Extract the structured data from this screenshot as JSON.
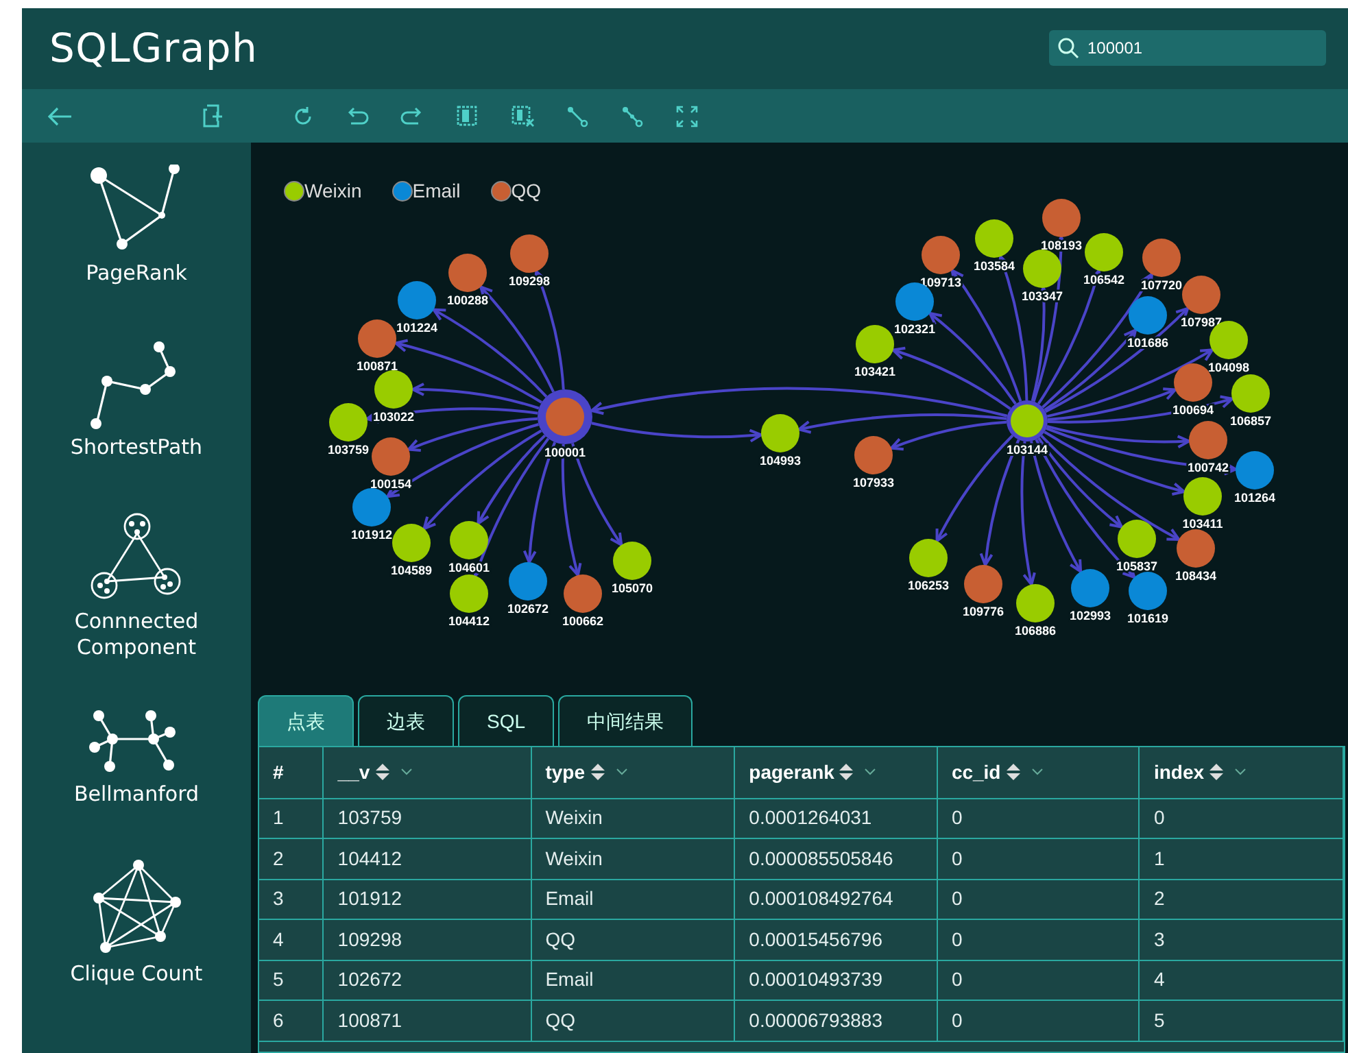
{
  "app": {
    "title": "SQLGraph"
  },
  "search": {
    "value": "100001"
  },
  "sidebar": {
    "items": [
      {
        "label": "PageRank"
      },
      {
        "label": "ShortestPath"
      },
      {
        "label": "Connnected Component"
      },
      {
        "label": "Bellmanford"
      },
      {
        "label": "Clique Count"
      }
    ]
  },
  "graph": {
    "legend": [
      {
        "label": "Weixin",
        "color": "#99cc00"
      },
      {
        "label": "Email",
        "color": "#0a88d6"
      },
      {
        "label": "QQ",
        "color": "#c85f33"
      }
    ],
    "nodes": [
      {
        "label": "100001",
        "color": "#c85f33",
        "selected": true
      },
      {
        "label": "100288",
        "color": "#c85f33",
        "selected": false
      },
      {
        "label": "109298",
        "color": "#c85f33",
        "selected": false
      },
      {
        "label": "101224",
        "color": "#0a88d6",
        "selected": false
      },
      {
        "label": "100871",
        "color": "#c85f33",
        "selected": false
      },
      {
        "label": "103022",
        "color": "#99cc00",
        "selected": false
      },
      {
        "label": "103759",
        "color": "#99cc00",
        "selected": false
      },
      {
        "label": "100154",
        "color": "#c85f33",
        "selected": false
      },
      {
        "label": "101912",
        "color": "#0a88d6",
        "selected": false
      },
      {
        "label": "104589",
        "color": "#99cc00",
        "selected": false
      },
      {
        "label": "104601",
        "color": "#99cc00",
        "selected": false
      },
      {
        "label": "104412",
        "color": "#99cc00",
        "selected": false
      },
      {
        "label": "102672",
        "color": "#0a88d6",
        "selected": false
      },
      {
        "label": "100662",
        "color": "#c85f33",
        "selected": false
      },
      {
        "label": "105070",
        "color": "#99cc00",
        "selected": false
      },
      {
        "label": "103144",
        "color": "#99cc00",
        "selected": false
      },
      {
        "label": "109713",
        "color": "#c85f33",
        "selected": false
      },
      {
        "label": "103584",
        "color": "#99cc00",
        "selected": false
      },
      {
        "label": "108193",
        "color": "#c85f33",
        "selected": false
      },
      {
        "label": "103347",
        "color": "#99cc00",
        "selected": false
      },
      {
        "label": "106542",
        "color": "#99cc00",
        "selected": false
      },
      {
        "label": "107720",
        "color": "#c85f33",
        "selected": false
      },
      {
        "label": "102321",
        "color": "#0a88d6",
        "selected": false
      },
      {
        "label": "101686",
        "color": "#0a88d6",
        "selected": false
      },
      {
        "label": "107987",
        "color": "#c85f33",
        "selected": false
      },
      {
        "label": "103421",
        "color": "#99cc00",
        "selected": false
      },
      {
        "label": "104098",
        "color": "#99cc00",
        "selected": false
      },
      {
        "label": "100694",
        "color": "#c85f33",
        "selected": false
      },
      {
        "label": "106857",
        "color": "#99cc00",
        "selected": false
      },
      {
        "label": "100742",
        "color": "#c85f33",
        "selected": false
      },
      {
        "label": "101264",
        "color": "#0a88d6",
        "selected": false
      },
      {
        "label": "103411",
        "color": "#99cc00",
        "selected": false
      },
      {
        "label": "108434",
        "color": "#c85f33",
        "selected": false
      },
      {
        "label": "105837",
        "color": "#99cc00",
        "selected": false
      },
      {
        "label": "102993",
        "color": "#0a88d6",
        "selected": false
      },
      {
        "label": "101619",
        "color": "#0a88d6",
        "selected": false
      },
      {
        "label": "106886",
        "color": "#99cc00",
        "selected": false
      },
      {
        "label": "109776",
        "color": "#c85f33",
        "selected": false
      },
      {
        "label": "106253",
        "color": "#99cc00",
        "selected": false
      },
      {
        "label": "107933",
        "color": "#c85f33",
        "selected": false
      },
      {
        "label": "104993",
        "color": "#99cc00",
        "selected": false
      }
    ]
  },
  "result_tabs": [
    {
      "label": "点表",
      "selected": true
    },
    {
      "label": "边表",
      "selected": false
    },
    {
      "label": "SQL",
      "selected": false
    },
    {
      "label": "中间结果",
      "selected": false
    }
  ],
  "table": {
    "columns": [
      {
        "label": "#",
        "sortable": false
      },
      {
        "label": "__v",
        "sortable": true
      },
      {
        "label": "type",
        "sortable": true
      },
      {
        "label": "pagerank",
        "sortable": true
      },
      {
        "label": "cc_id",
        "sortable": true
      },
      {
        "label": "index",
        "sortable": true
      }
    ],
    "rows": [
      [
        "1",
        "103759",
        "Weixin",
        "0.0001264031",
        "0",
        "0"
      ],
      [
        "2",
        "104412",
        "Weixin",
        "0.000085505846",
        "0",
        "1"
      ],
      [
        "3",
        "101912",
        "Email",
        "0.000108492764",
        "0",
        "2"
      ],
      [
        "4",
        "109298",
        "QQ",
        "0.00015456796",
        "0",
        "3"
      ],
      [
        "5",
        "102672",
        "Email",
        "0.00010493739",
        "0",
        "4"
      ],
      [
        "6",
        "100871",
        "QQ",
        "0.00006793883",
        "0",
        "5"
      ]
    ]
  }
}
